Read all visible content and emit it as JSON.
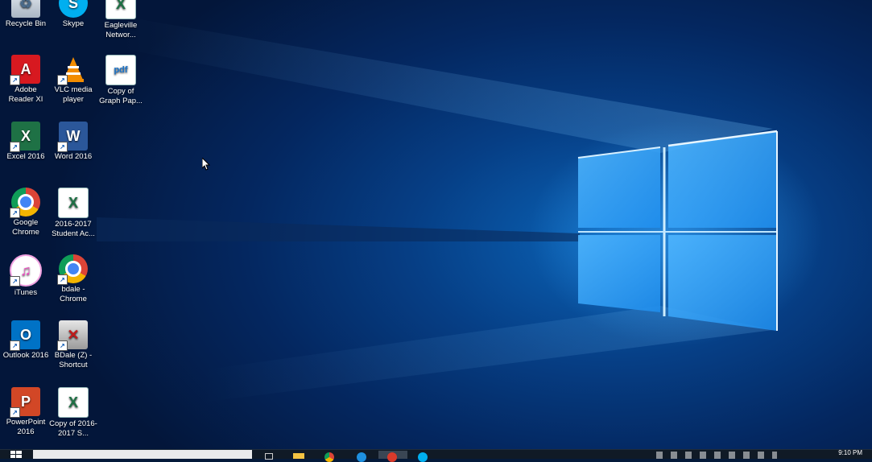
{
  "desktop": {
    "icons": [
      {
        "label": "Recycle Bin",
        "icon": "recycle-bin-icon",
        "color": "#cfd8e3"
      },
      {
        "label": "Skype",
        "icon": "skype-icon",
        "color": "#00aff0"
      },
      {
        "label": "Eagleville Networ...",
        "icon": "excel-file-icon",
        "color": "#1e7145"
      },
      {
        "label": "Adobe Reader XI",
        "icon": "adobe-reader-icon",
        "color": "#d71920"
      },
      {
        "label": "VLC media player",
        "icon": "vlc-icon",
        "color": "#f28c00"
      },
      {
        "label": "Copy of Graph Pap...",
        "icon": "pdf-file-icon",
        "color": "#1a73c9"
      },
      {
        "label": "Excel 2016",
        "icon": "excel-icon",
        "color": "#1e7145"
      },
      {
        "label": "Word 2016",
        "icon": "word-icon",
        "color": "#2b579a"
      },
      {
        "label": "Google Chrome",
        "icon": "chrome-icon",
        "color": "#db4437"
      },
      {
        "label": "2016-2017 Student Ac...",
        "icon": "excel-file-icon",
        "color": "#1e7145"
      },
      {
        "label": "iTunes",
        "icon": "itunes-icon",
        "color": "#ea4cc0"
      },
      {
        "label": "bdale - Chrome",
        "icon": "chrome-profile-icon",
        "color": "#db4437"
      },
      {
        "label": "Outlook 2016",
        "icon": "outlook-icon",
        "color": "#0072c6"
      },
      {
        "label": "BDale (Z) - Shortcut",
        "icon": "network-drive-icon",
        "color": "#c01a1a"
      },
      {
        "label": "PowerPoint 2016",
        "icon": "powerpoint-icon",
        "color": "#d24726"
      },
      {
        "label": "Copy of 2016-2017 S...",
        "icon": "excel-file-icon",
        "color": "#1e7145"
      }
    ]
  },
  "taskbar": {
    "clock": "9:10 PM",
    "apps": [
      "task-view-icon",
      "file-explorer-icon",
      "chrome-taskbar-icon",
      "internet-explorer-icon",
      "recording-app-icon",
      "skype-taskbar-icon"
    ]
  }
}
